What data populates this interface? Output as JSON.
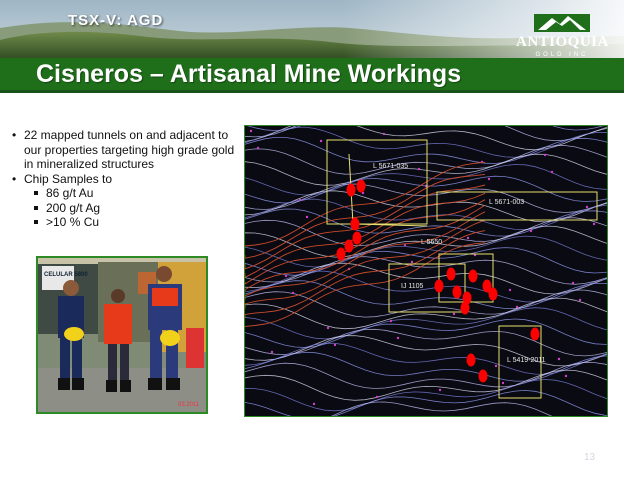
{
  "header": {
    "ticker": "TSX-V: AGD",
    "logo_name": "ANTIOQUIA",
    "logo_sub": "GOLD INC",
    "brand_green": "#1f6e1a"
  },
  "slide": {
    "title": "Cisneros – Artisanal Mine Workings",
    "page_number": "13"
  },
  "bullets": {
    "b1": "22 mapped tunnels on and adjacent to our properties targeting high grade gold in mineralized structures",
    "b2": "Chip Samples to",
    "sub": [
      "86 g/t Au",
      "200 g/t Ag",
      ">10 % Cu"
    ]
  },
  "photo": {
    "sign_text": "CELULAR 5800",
    "date_stamp": "03.2011"
  },
  "map": {
    "labels": [
      "L 5671-035",
      "L 5671-003",
      "L 5650",
      "IJ 1105",
      "L 5419-2011"
    ],
    "marker_color": "#ff0000",
    "outline_color": "#e8e070"
  }
}
